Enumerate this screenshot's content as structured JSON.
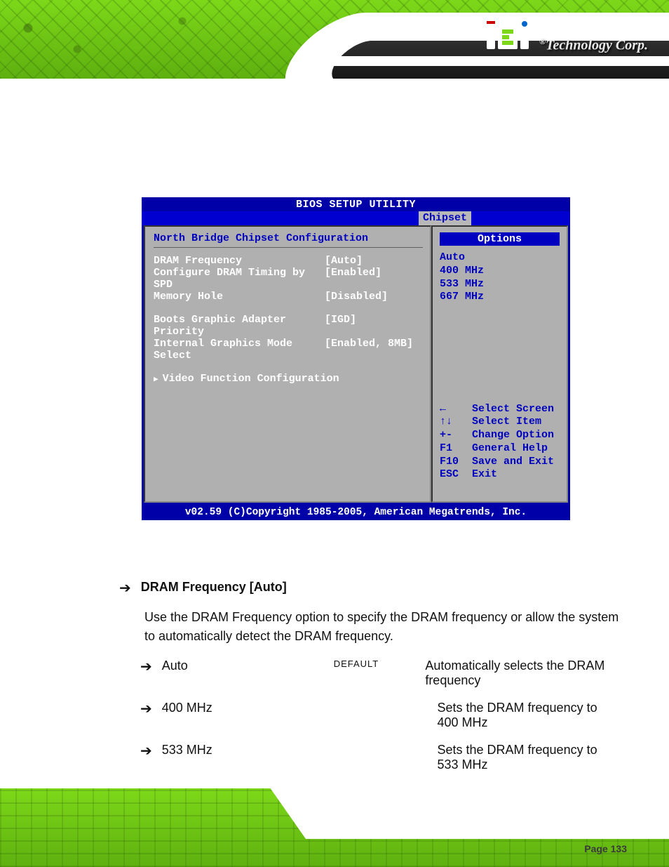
{
  "header": {
    "brand_text": "Technology Corp.",
    "logo_name": "iEi"
  },
  "footer": {
    "page_label": "Page 133"
  },
  "bios": {
    "title": "BIOS SETUP UTILITY",
    "active_tab": "Chipset",
    "section_title": "North Bridge Chipset Configuration",
    "settings": [
      {
        "label": "DRAM Frequency",
        "value": "[Auto]"
      },
      {
        "label": "Configure DRAM Timing by SPD",
        "value": "[Enabled]"
      },
      {
        "label": "Memory Hole",
        "value": "[Disabled]"
      }
    ],
    "settings2": [
      {
        "label": "Boots Graphic Adapter Priority",
        "value": "[IGD]"
      },
      {
        "label": "Internal Graphics Mode Select",
        "value": "[Enabled, 8MB]"
      }
    ],
    "submenu": "Video Function Configuration",
    "options_header": "Options",
    "options": [
      "Auto",
      "400 MHz",
      "533 MHz",
      "667 MHz"
    ],
    "nav": [
      {
        "key": "←",
        "action": "Select Screen"
      },
      {
        "key": "↑↓",
        "action": "Select Item"
      },
      {
        "key": "+-",
        "action": "Change Option"
      },
      {
        "key": "F1",
        "action": "General Help"
      },
      {
        "key": "F10",
        "action": "Save and Exit"
      },
      {
        "key": "ESC",
        "action": "Exit"
      }
    ],
    "copyright": "v02.59 (C)Copyright 1985-2005, American Megatrends, Inc."
  },
  "body": {
    "heading": "DRAM Frequency [Auto]",
    "intro": "Use the DRAM Frequency option to specify the DRAM frequency or allow the system to automatically detect the DRAM frequency.",
    "rows": [
      {
        "label": "Auto",
        "mid": "DEFAULT",
        "desc": "Automatically selects the DRAM frequency"
      },
      {
        "label": "400 MHz",
        "mid": "",
        "desc": "Sets the DRAM frequency to 400 MHz"
      },
      {
        "label": "533 MHz",
        "mid": "",
        "desc": "Sets the DRAM frequency to 533 MHz"
      }
    ]
  }
}
